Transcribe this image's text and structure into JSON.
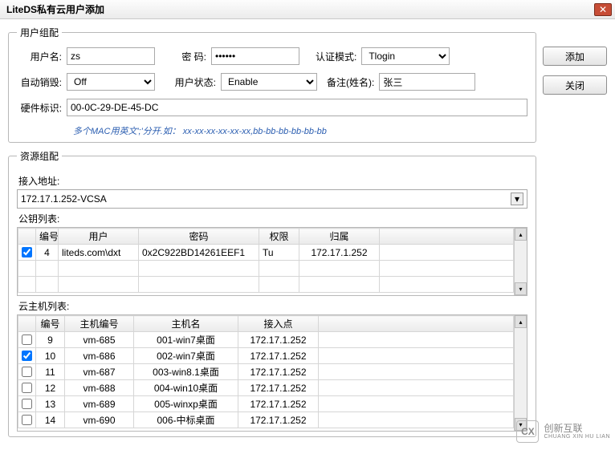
{
  "window": {
    "title": "LiteDS私有云用户添加"
  },
  "buttons": {
    "add": "添加",
    "close": "关闭",
    "close_x": "✕"
  },
  "userGroup": {
    "legend": "用户组配",
    "username_label": "用户名:",
    "username": "zs",
    "password_label": "密  码:",
    "password": "••••••",
    "authmode_label": "认证模式:",
    "authmode": "Tlogin",
    "autodestroy_label": "自动销毁:",
    "autodestroy": "Off",
    "userstatus_label": "用户状态:",
    "userstatus": "Enable",
    "remark_label": "备注(姓名):",
    "remark": "张三",
    "hwid_label": "硬件标识:",
    "hwid": "00-0C-29-DE-45-DC",
    "hint": "多个MAC用英文';'分开.如：  xx-xx-xx-xx-xx-xx,bb-bb-bb-bb-bb-bb"
  },
  "resourceGroup": {
    "legend": "资源组配",
    "access_label": "接入地址:",
    "access_value": "172.17.1.252-VCSA",
    "pubkey_label": "公钥列表:",
    "pubkey_headers": {
      "no": "编号",
      "user": "用户",
      "pwd": "密码",
      "perm": "权限",
      "belong": "归属"
    },
    "pubkey_rows": [
      {
        "checked": true,
        "no": "4",
        "user": "liteds.com\\dxt",
        "pwd": "0x2C922BD14261EEF1",
        "perm": "Tu",
        "belong": "172.17.1.252"
      }
    ],
    "vm_label": "云主机列表:",
    "vm_headers": {
      "no": "编号",
      "hostno": "主机编号",
      "hostname": "主机名",
      "access": "接入点"
    },
    "vm_rows": [
      {
        "checked": false,
        "no": "9",
        "hostno": "vm-685",
        "hostname": "001-win7桌面",
        "access": "172.17.1.252"
      },
      {
        "checked": true,
        "no": "10",
        "hostno": "vm-686",
        "hostname": "002-win7桌面",
        "access": "172.17.1.252"
      },
      {
        "checked": false,
        "no": "11",
        "hostno": "vm-687",
        "hostname": "003-win8.1桌面",
        "access": "172.17.1.252"
      },
      {
        "checked": false,
        "no": "12",
        "hostno": "vm-688",
        "hostname": "004-win10桌面",
        "access": "172.17.1.252"
      },
      {
        "checked": false,
        "no": "13",
        "hostno": "vm-689",
        "hostname": "005-winxp桌面",
        "access": "172.17.1.252"
      },
      {
        "checked": false,
        "no": "14",
        "hostno": "vm-690",
        "hostname": "006-中标桌面",
        "access": "172.17.1.252"
      }
    ]
  },
  "watermark": {
    "logo": "CX",
    "zh": "创新互联",
    "en": "CHUANG XIN HU LIAN"
  }
}
